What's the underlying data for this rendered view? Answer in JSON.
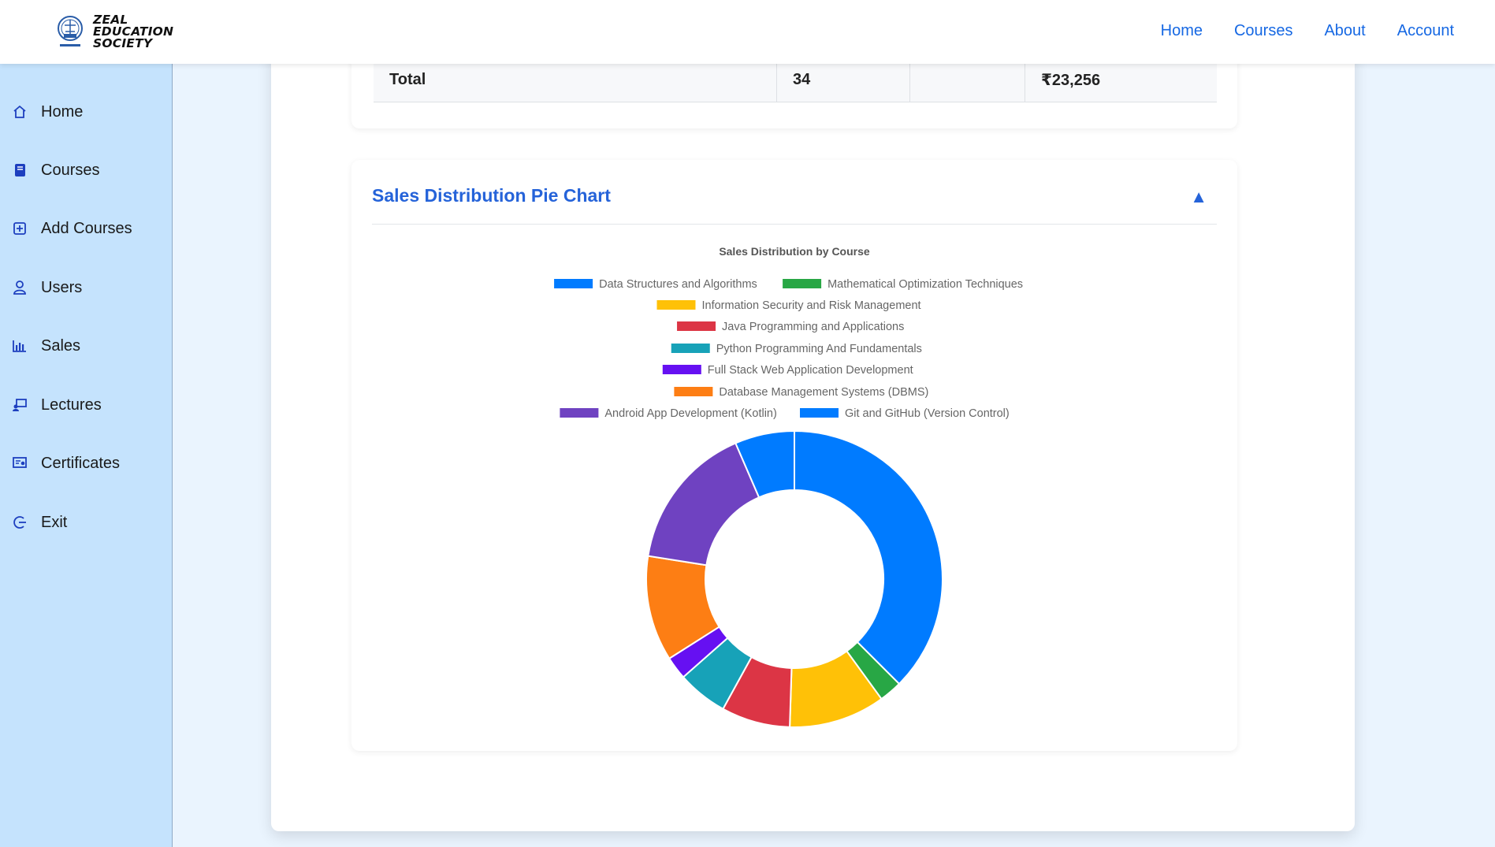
{
  "brand": {
    "line1": "ZEAL",
    "line2": "EDUCATION",
    "line3": "SOCIETY"
  },
  "topnav": [
    "Home",
    "Courses",
    "About",
    "Account"
  ],
  "sidebar": {
    "items": [
      {
        "label": "Home",
        "icon": "home-icon"
      },
      {
        "label": "Courses",
        "icon": "book-icon"
      },
      {
        "label": "Add Courses",
        "icon": "add-box-icon"
      },
      {
        "label": "Users",
        "icon": "user-icon"
      },
      {
        "label": "Sales",
        "icon": "bar-chart-icon"
      },
      {
        "label": "Lectures",
        "icon": "presentation-icon"
      },
      {
        "label": "Certificates",
        "icon": "certificate-icon"
      },
      {
        "label": "Exit",
        "icon": "exit-icon"
      }
    ]
  },
  "table": {
    "total_label": "Total",
    "total_qty": "34",
    "total_empty": "",
    "total_amount": "₹23,256"
  },
  "chart_section": {
    "heading": "Sales Distribution Pie Chart",
    "toggle": "▲"
  },
  "chart_data": {
    "type": "pie",
    "variant": "doughnut",
    "title": "Sales Distribution by Course",
    "legend_position": "top",
    "series": [
      {
        "name": "Data Structures and Algorithms",
        "value": 37.5,
        "color": "#007bff"
      },
      {
        "name": "Mathematical Optimization Techniques",
        "value": 2.5,
        "color": "#28a745"
      },
      {
        "name": "Information Security and Risk Management",
        "value": 10.5,
        "color": "#ffc107"
      },
      {
        "name": "Java Programming and Applications",
        "value": 7.5,
        "color": "#dc3545"
      },
      {
        "name": "Python Programming And Fundamentals",
        "value": 5.5,
        "color": "#17a2b8"
      },
      {
        "name": "Full Stack Web Application Development",
        "value": 2.5,
        "color": "#6610f2"
      },
      {
        "name": "Database Management Systems (DBMS)",
        "value": 11.5,
        "color": "#fd7e14"
      },
      {
        "name": "Android App Development (Kotlin)",
        "value": 16.0,
        "color": "#6f42c1"
      },
      {
        "name": "Git and GitHub (Version Control)",
        "value": 6.5,
        "color": "#007bff"
      }
    ]
  }
}
